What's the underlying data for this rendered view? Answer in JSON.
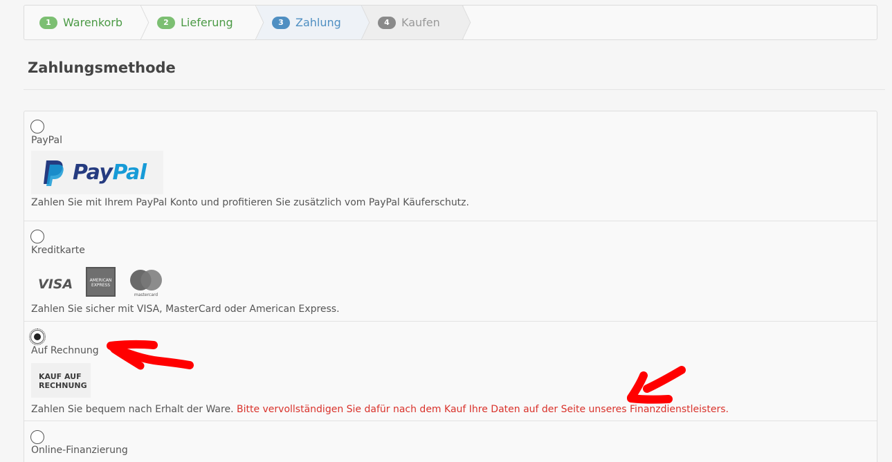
{
  "steps": [
    {
      "num": "1",
      "label": "Warenkorb",
      "state": "done"
    },
    {
      "num": "2",
      "label": "Lieferung",
      "state": "done"
    },
    {
      "num": "3",
      "label": "Zahlung",
      "state": "active"
    },
    {
      "num": "4",
      "label": "Kaufen",
      "state": "todo"
    }
  ],
  "page_title": "Zahlungsmethode",
  "methods": [
    {
      "name": "PayPal",
      "checked": false,
      "logo": {
        "text_a": "Pay",
        "text_b": "Pal"
      },
      "description": "Zahlen Sie mit Ihrem PayPal Konto und profitieren Sie zusätzlich vom PayPal Käuferschutz."
    },
    {
      "name": "Kreditkarte",
      "checked": false,
      "logos": {
        "visa": "VISA",
        "amex": "AMERICAN EXPRESS",
        "mastercard": "mastercard"
      },
      "description": "Zahlen Sie sicher mit VISA, MasterCard oder American Express."
    },
    {
      "name": "Auf Rechnung",
      "checked": true,
      "logo": {
        "line1": "KAUF AUF",
        "line2": "RECHNUNG"
      },
      "description": "Zahlen Sie bequem nach Erhalt der Ware.",
      "notice": "Bitte vervollständigen Sie dafür nach dem Kauf Ihre Daten auf der Seite unseres Finanzdienstleisters."
    },
    {
      "name": "Online-Finanzierung",
      "checked": false
    }
  ],
  "colors": {
    "done": "#4b9a45",
    "active": "#4f8fc2",
    "warning": "#d9322b",
    "annotation": "#ff0000"
  }
}
